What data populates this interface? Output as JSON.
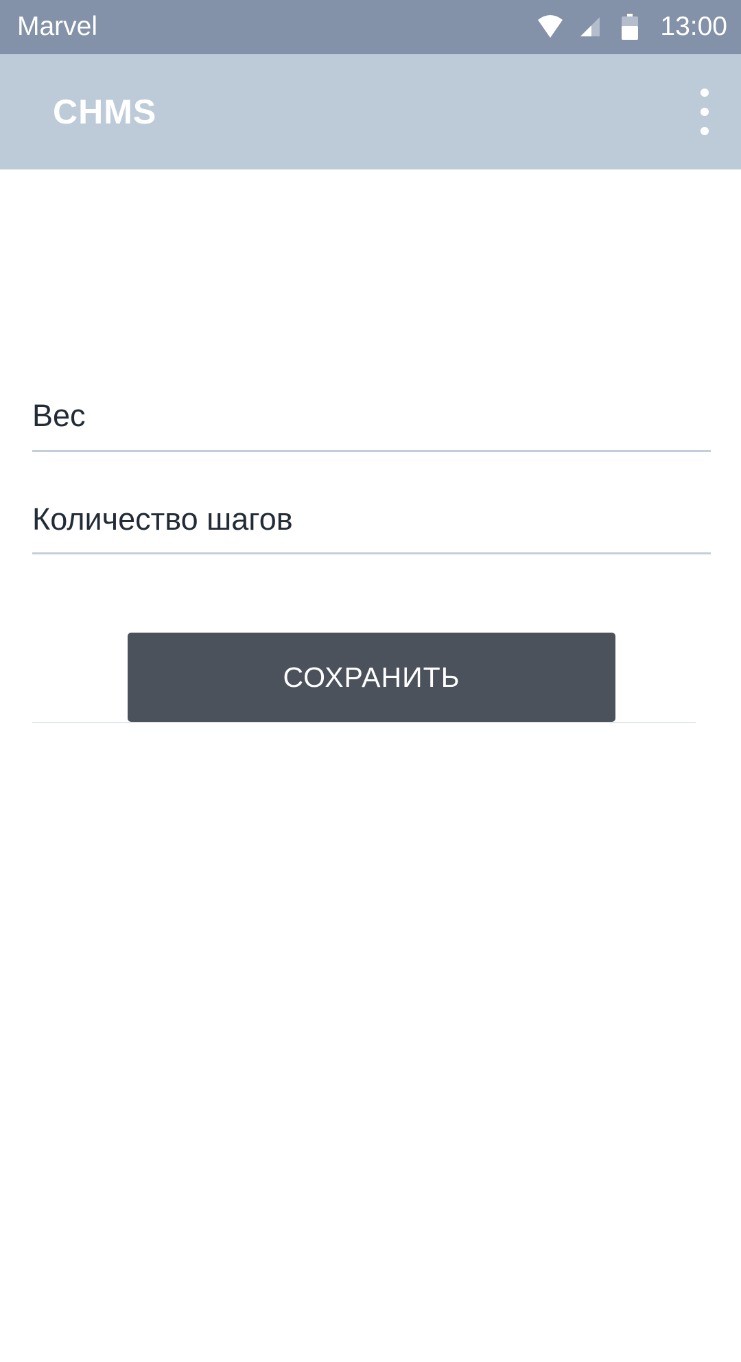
{
  "status_bar": {
    "carrier": "Marvel",
    "time": "13:00",
    "icons": [
      "wifi-icon",
      "signal-icon",
      "battery-icon"
    ]
  },
  "app_bar": {
    "title": "CHMS",
    "menu_icon": "more-vert-icon"
  },
  "form": {
    "weight_placeholder": "Вес",
    "weight_value": "",
    "steps_placeholder": "Количество шагов",
    "steps_value": "",
    "save_label": "СОХРАНИТЬ"
  },
  "colors": {
    "status_bar": "#8392a8",
    "app_bar": "#bdcbd9",
    "button": "#4b525c",
    "underline": "#c4ceda"
  }
}
